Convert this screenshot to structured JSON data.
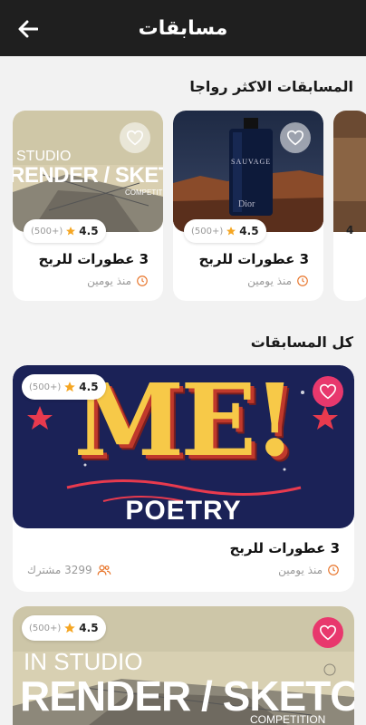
{
  "appbar": {
    "title": "مسابقات"
  },
  "popular": {
    "title": "المسابقات الاكثر رواجا",
    "cards": [
      {
        "image_text": [
          "STUDIO",
          "RENDER / SKETCH",
          "COMPETITION"
        ],
        "rating": "4.5",
        "count": "(500+)",
        "title": "3 عطورات للربح",
        "time": "منذ يومين"
      },
      {
        "image_text": [
          "SAUVAGE",
          "Dior"
        ],
        "rating": "4.5",
        "count": "(500+)",
        "title": "3 عطورات للربح",
        "time": "منذ يومين"
      },
      {
        "rating": "4"
      }
    ]
  },
  "all": {
    "title": "كل المسابقات",
    "cards": [
      {
        "image_text": [
          "ME!",
          "POETRY"
        ],
        "rating": "4.5",
        "count": "(500+)",
        "title": "3 عطورات للربح",
        "time": "منذ يومين",
        "participants": "3299 مشترك"
      },
      {
        "image_text": [
          "IN STUDIO",
          "RENDER / SKETCH",
          "COMPETITION"
        ],
        "rating": "4.5",
        "count": "(500+)"
      }
    ]
  },
  "colors": {
    "accent": "#e8386d",
    "star": "#f5a623",
    "clock": "#e8762c",
    "appbar": "#1f1f1f"
  },
  "icons": {
    "back": "arrow-left-icon",
    "favorite": "heart-icon",
    "star": "star-icon",
    "time": "clock-icon",
    "participants": "users-icon"
  }
}
